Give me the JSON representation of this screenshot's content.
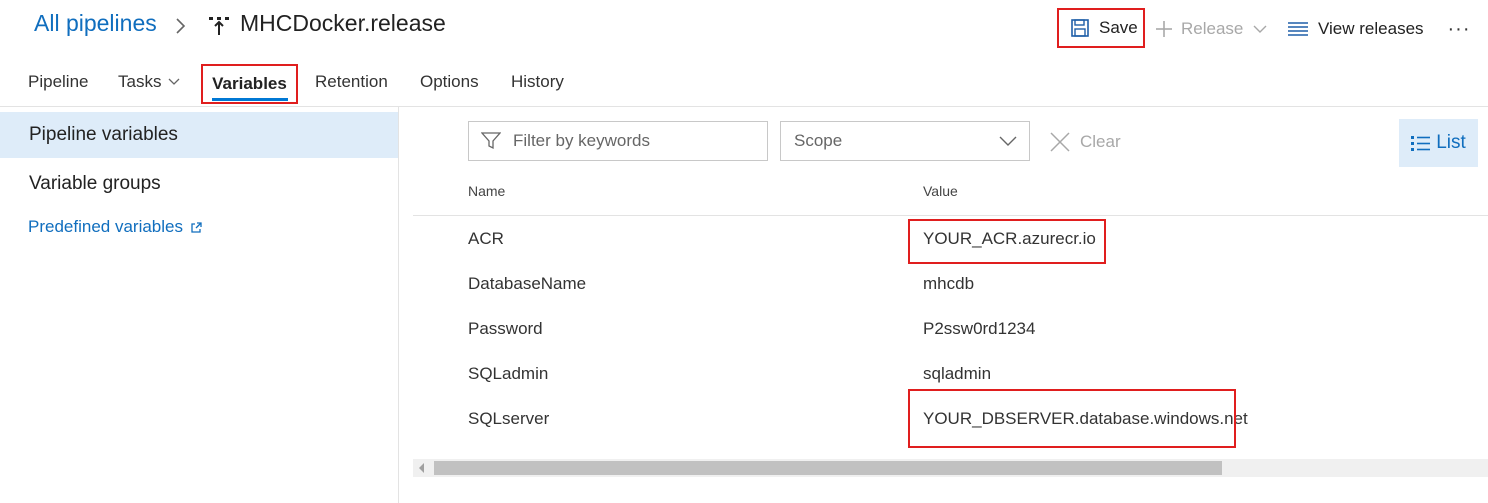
{
  "breadcrumb": {
    "root": "All pipelines",
    "pipeline_name": "MHCDocker.release"
  },
  "toolbar": {
    "save": "Save",
    "release": "Release",
    "view_releases": "View releases",
    "more": "···"
  },
  "tabs": [
    "Pipeline",
    "Tasks",
    "Variables",
    "Retention",
    "Options",
    "History"
  ],
  "active_tab": "Variables",
  "sidebar": {
    "selected": "Pipeline variables",
    "items": [
      "Variable groups"
    ],
    "link": "Predefined variables"
  },
  "filterbar": {
    "filter_placeholder": "Filter by keywords",
    "scope": "Scope",
    "clear": "Clear",
    "list": "List"
  },
  "grid": {
    "columns": [
      "Name",
      "Value"
    ],
    "rows": [
      {
        "name": "ACR",
        "value": "YOUR_ACR.azurecr.io",
        "highlighted": true
      },
      {
        "name": "DatabaseName",
        "value": "mhcdb",
        "highlighted": false
      },
      {
        "name": "Password",
        "value": "P2ssw0rd1234",
        "highlighted": false
      },
      {
        "name": "SQLadmin",
        "value": "sqladmin",
        "highlighted": false
      },
      {
        "name": "SQLserver",
        "value": "YOUR_DBSERVER.database.windows.net",
        "highlighted": true
      }
    ]
  },
  "colors": {
    "accent": "#0078d4",
    "link": "#106ebe",
    "selection": "#deecf9",
    "highlight_box": "#e01e1e"
  },
  "icons": [
    "chevron-right-icon",
    "release-pipeline-icon",
    "save-icon",
    "plus-icon",
    "chevron-down-icon",
    "list-lines-icon",
    "external-link-icon",
    "filter-funnel-icon",
    "close-x-icon",
    "list-view-icon"
  ]
}
